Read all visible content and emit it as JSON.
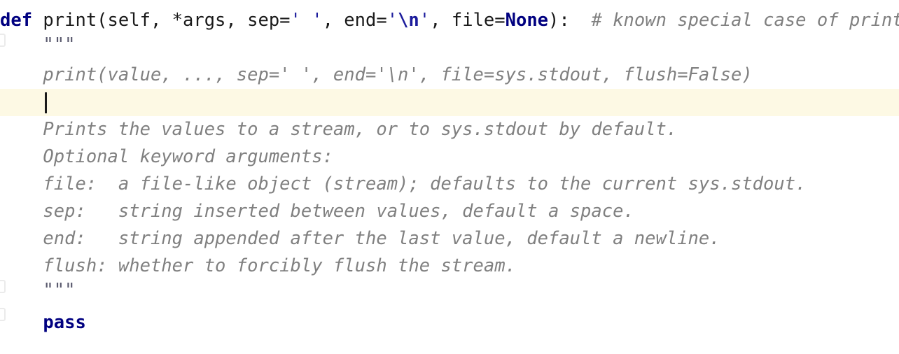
{
  "editor": {
    "language": "python",
    "background_color": "#ffffff",
    "current_line_highlight_color": "#fdf9e4",
    "caret_color": "#1b1b1b",
    "font_size_px": 25,
    "line_height_px": 39,
    "keyword_color": "#000080",
    "string_color": "#1c1c9c",
    "comment_color": "#808080",
    "docstring_color": "#808080",
    "docquote_color": "#5a5a6e",
    "plain_text_color": "#1a1a1a"
  },
  "code": {
    "line1": {
      "kw_def": "def",
      "signature_a": " print(self, *args, sep=",
      "str_sep": "' '",
      "signature_b": ", end=",
      "str_end_open": "'",
      "str_end_esc": "\\n",
      "str_end_close": "'",
      "signature_c": ", file=",
      "kw_none": "None",
      "signature_d": "):",
      "comment": "# known special case of print"
    },
    "line2": {
      "indent": "    ",
      "quote": "\"\"\""
    },
    "line3": {
      "indent": "    ",
      "text": "print(value, ..., sep=' ', end='\\n', file=sys.stdout, flush=False)"
    },
    "line4": {
      "indent": "    ",
      "text": ""
    },
    "line5": {
      "indent": "    ",
      "text": "Prints the values to a stream, or to sys.stdout by default."
    },
    "line6": {
      "indent": "    ",
      "text": "Optional keyword arguments:"
    },
    "line7": {
      "indent": "    ",
      "text": "file:  a file-like object (stream); defaults to the current sys.stdout."
    },
    "line8": {
      "indent": "    ",
      "text": "sep:   string inserted between values, default a space."
    },
    "line9": {
      "indent": "    ",
      "text": "end:   string appended after the last value, default a newline."
    },
    "line10": {
      "indent": "    ",
      "text": "flush: whether to forcibly flush the stream."
    },
    "line11": {
      "indent": "    ",
      "quote": "\"\"\""
    },
    "line12": {
      "indent": "    ",
      "kw_pass": "pass"
    }
  }
}
